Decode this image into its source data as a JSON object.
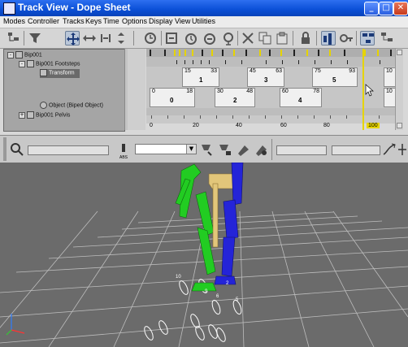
{
  "window": {
    "title": "Track View - Dope Sheet",
    "controls": {
      "minimize": "_",
      "maximize": "□",
      "close": "✕"
    }
  },
  "menubar": {
    "items": [
      "Modes",
      "Controller",
      "Tracks",
      "Keys",
      "Time",
      "Options",
      "Display",
      "View",
      "Utilities"
    ]
  },
  "toolbar": {
    "icons": [
      "filter-icon",
      "move-keys-icon",
      "slide-keys-icon",
      "scale-keys-icon",
      "scale-values-icon",
      "insert-time-icon",
      "scale-time-icon",
      "select-time-icon",
      "delete-time-icon",
      "reverse-time-icon",
      "cut-icon",
      "copy-icon",
      "paste-icon",
      "lock-selection-icon",
      "snap-frames-icon",
      "show-keyable-icon",
      "edit-keys-icon",
      "edit-ranges-icon"
    ]
  },
  "tree": {
    "rows": [
      {
        "label": "Bip001",
        "indent": 0
      },
      {
        "label": "Bip001 Footsteps",
        "indent": 1
      },
      {
        "label": "Transform",
        "indent": 2,
        "selected": true
      },
      {
        "label": "Object (Biped Object)",
        "indent": 2
      },
      {
        "label": "Bip001 Pelvis",
        "indent": 1
      }
    ]
  },
  "dope_sheet": {
    "row1_blocks": [
      {
        "start": "15",
        "end": "33",
        "num": "1"
      },
      {
        "start": "45",
        "end": "63",
        "num": "3"
      },
      {
        "start": "75",
        "end": "93",
        "num": "5"
      },
      {
        "start": "10",
        "end": "",
        "num": ""
      }
    ],
    "row2_blocks": [
      {
        "start": "0",
        "end": "18",
        "num": "0"
      },
      {
        "start": "30",
        "end": "48",
        "num": "2"
      },
      {
        "start": "60",
        "end": "78",
        "num": "4"
      },
      {
        "start": "10",
        "end": "",
        "num": ""
      }
    ],
    "ruler_labels": [
      "0",
      "20",
      "40",
      "60",
      "80",
      "100"
    ],
    "current_frame": "100"
  },
  "statusbar": {
    "rel_label": "ABS",
    "icons": [
      "zoom-icon",
      "pan-icon",
      "key-filter-icon",
      "set-key-icon",
      "select-keys-icon",
      "zoom-region-icon",
      "curve-icon"
    ]
  },
  "viewport": {
    "footstep_labels": [
      "10",
      "9",
      "6",
      "5",
      "2"
    ]
  }
}
